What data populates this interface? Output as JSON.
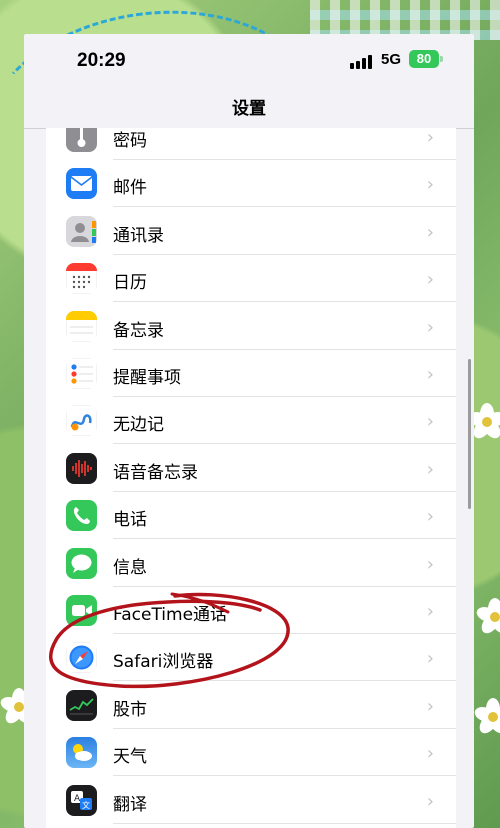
{
  "status_bar": {
    "time": "20:29",
    "network": "5G",
    "battery": "80",
    "battery_color": "#34c759"
  },
  "nav": {
    "title": "设置"
  },
  "settings_items": [
    {
      "label": "密码",
      "icon": "key-icon",
      "color": "#8e8e93"
    },
    {
      "label": "邮件",
      "icon": "mail-icon",
      "color": "#1e7cf5"
    },
    {
      "label": "通讯录",
      "icon": "contacts-icon",
      "color": "#b9b9bd"
    },
    {
      "label": "日历",
      "icon": "calendar-icon",
      "color": "#ff3b30"
    },
    {
      "label": "备忘录",
      "icon": "notes-icon",
      "color": "#ffcc00"
    },
    {
      "label": "提醒事项",
      "icon": "reminders-icon",
      "color": "#ff9500"
    },
    {
      "label": "无边记",
      "icon": "freeform-icon",
      "color": "#2b85e0"
    },
    {
      "label": "语音备忘录",
      "icon": "voice-memos-icon",
      "color": "#1c1c1e"
    },
    {
      "label": "电话",
      "icon": "phone-icon",
      "color": "#34c759"
    },
    {
      "label": "信息",
      "icon": "messages-icon",
      "color": "#34c759"
    },
    {
      "label": "FaceTime通话",
      "icon": "facetime-icon",
      "color": "#34c759"
    },
    {
      "label": "Safari浏览器",
      "icon": "safari-icon",
      "color": "#1e7cf5"
    },
    {
      "label": "股市",
      "icon": "stocks-icon",
      "color": "#1c1c1e"
    },
    {
      "label": "天气",
      "icon": "weather-icon",
      "color": "#2a8be0"
    },
    {
      "label": "翻译",
      "icon": "translate-icon",
      "color": "#1c1c1e"
    }
  ],
  "chevron": "›"
}
